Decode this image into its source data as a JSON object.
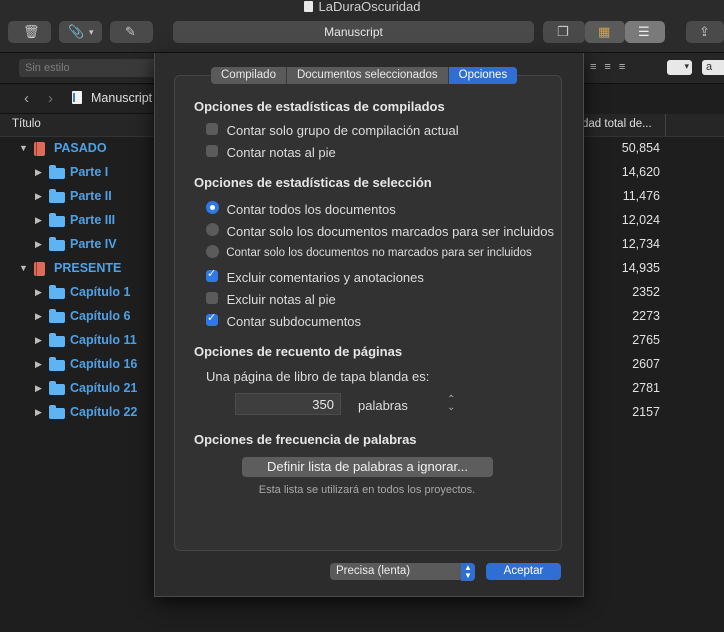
{
  "window": {
    "title": "LaDuraOscuridad",
    "center_title": "Manuscript"
  },
  "format_bar": {
    "style_placeholder": "Sin estilo",
    "font_size_value": "a"
  },
  "binder": {
    "nav_title": "Manuscript",
    "column_title": "Título",
    "items": [
      {
        "label": "PASADO",
        "kind": "book"
      },
      {
        "label": "Parte I",
        "kind": "folder"
      },
      {
        "label": "Parte II",
        "kind": "folder"
      },
      {
        "label": "Parte III",
        "kind": "folder"
      },
      {
        "label": "Parte IV",
        "kind": "folder"
      },
      {
        "label": "PRESENTE",
        "kind": "book"
      },
      {
        "label": "Capítulo 1",
        "kind": "folder"
      },
      {
        "label": "Capítulo 6",
        "kind": "folder"
      },
      {
        "label": "Capítulo 11",
        "kind": "folder"
      },
      {
        "label": "Capítulo 16",
        "kind": "folder"
      },
      {
        "label": "Capítulo 21",
        "kind": "folder"
      },
      {
        "label": "Capítulo 22",
        "kind": "folder"
      }
    ]
  },
  "totals_column": {
    "header": "dad total de...",
    "values": [
      "50,854",
      "14,620",
      "11,476",
      "12,024",
      "12,734",
      "14,935",
      "2352",
      "2273",
      "2765",
      "2607",
      "2781",
      "2157"
    ]
  },
  "sheet": {
    "tabs": [
      "Compilado",
      "Documentos seleccionados",
      "Opciones"
    ],
    "active_tab": "Opciones",
    "compile_section": {
      "title": "Opciones de estadísticas de compilados",
      "options": [
        {
          "label": "Contar solo grupo de compilación actual",
          "checked": false
        },
        {
          "label": "Contar notas al pie",
          "checked": false
        }
      ]
    },
    "selection_section": {
      "title": "Opciones de estadísticas de selección",
      "radios": [
        {
          "label": "Contar todos los documentos",
          "selected": true
        },
        {
          "label": "Contar solo los documentos marcados para ser incluidos",
          "selected": false
        },
        {
          "label": "Contar solo los documentos no marcados para ser incluidos",
          "selected": false
        }
      ],
      "checks": [
        {
          "label": "Excluir comentarios y anotaciones",
          "checked": true
        },
        {
          "label": "Excluir notas al pie",
          "checked": false
        },
        {
          "label": "Contar subdocumentos",
          "checked": true
        }
      ]
    },
    "pages_section": {
      "title": "Opciones de recuento de páginas",
      "prompt": "Una página de libro de tapa blanda es:",
      "value": "350",
      "unit": "palabras"
    },
    "frequency_section": {
      "title": "Opciones de frecuencia de palabras",
      "button": "Definir lista de palabras a ignorar...",
      "note": "Esta lista se utilizará en todos los proyectos."
    },
    "precision": "Precisa (lenta)",
    "accept": "Aceptar"
  },
  "colors": {
    "accent": "#2f6fd4",
    "binder_label": "#4ea1e8",
    "book": "#e06a5a",
    "folder": "#5eb4f2"
  }
}
